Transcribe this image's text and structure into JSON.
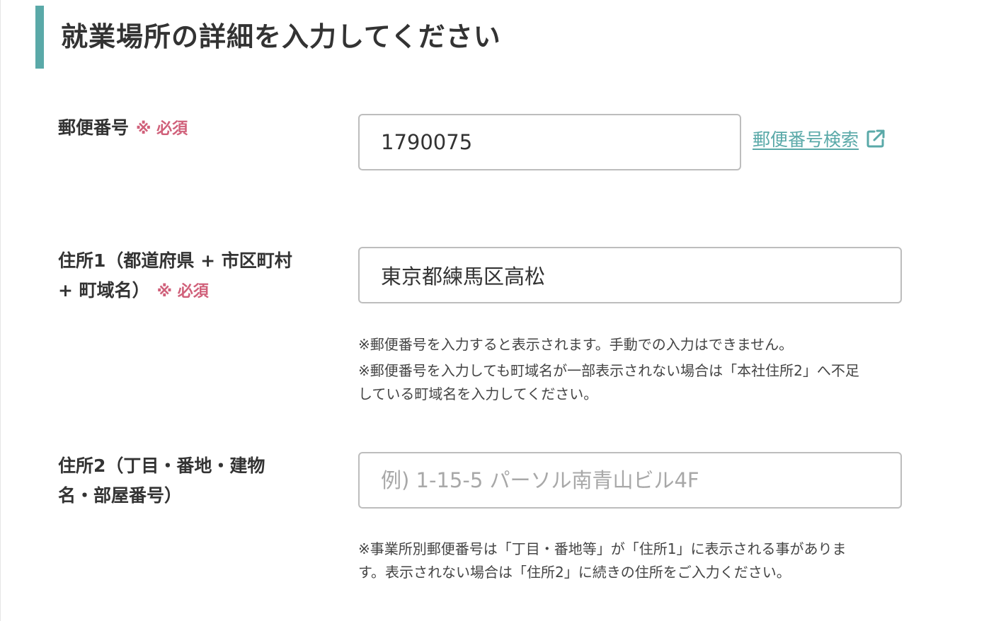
{
  "section": {
    "title": "就業場所の詳細を入力してください"
  },
  "fields": {
    "postal": {
      "label": "郵便番号",
      "required": "※ 必須",
      "value": "1790075",
      "link": "郵便番号検索"
    },
    "address1": {
      "label_line1": "住所1（都道府県 + 市区町村",
      "label_line2": "+ 町域名）",
      "required": "※ 必須",
      "value": "東京都練馬区高松",
      "note1": "※郵便番号を入力すると表示されます。手動での入力はできません。",
      "note2_line1": "※郵便番号を入力しても町域名が一部表示されない場合は「本社住所2」へ不足",
      "note2_line2": "している町域名を入力してください。"
    },
    "address2": {
      "label_line1": "住所2（丁目・番地・建物",
      "label_line2": "名・部屋番号）",
      "value": "",
      "placeholder": "例) 1-15-5 パーソル南青山ビル4F",
      "note_line1": "※事業所別郵便番号は「丁目・番地等」が「住所1」に表示される事がありま",
      "note_line2": "す。表示されない場合は「住所2」に続きの住所をご入力ください。"
    }
  },
  "colors": {
    "accent": "#5aa9a8",
    "required": "#d0607a"
  },
  "icons": {
    "external_link": "external-link-icon"
  }
}
